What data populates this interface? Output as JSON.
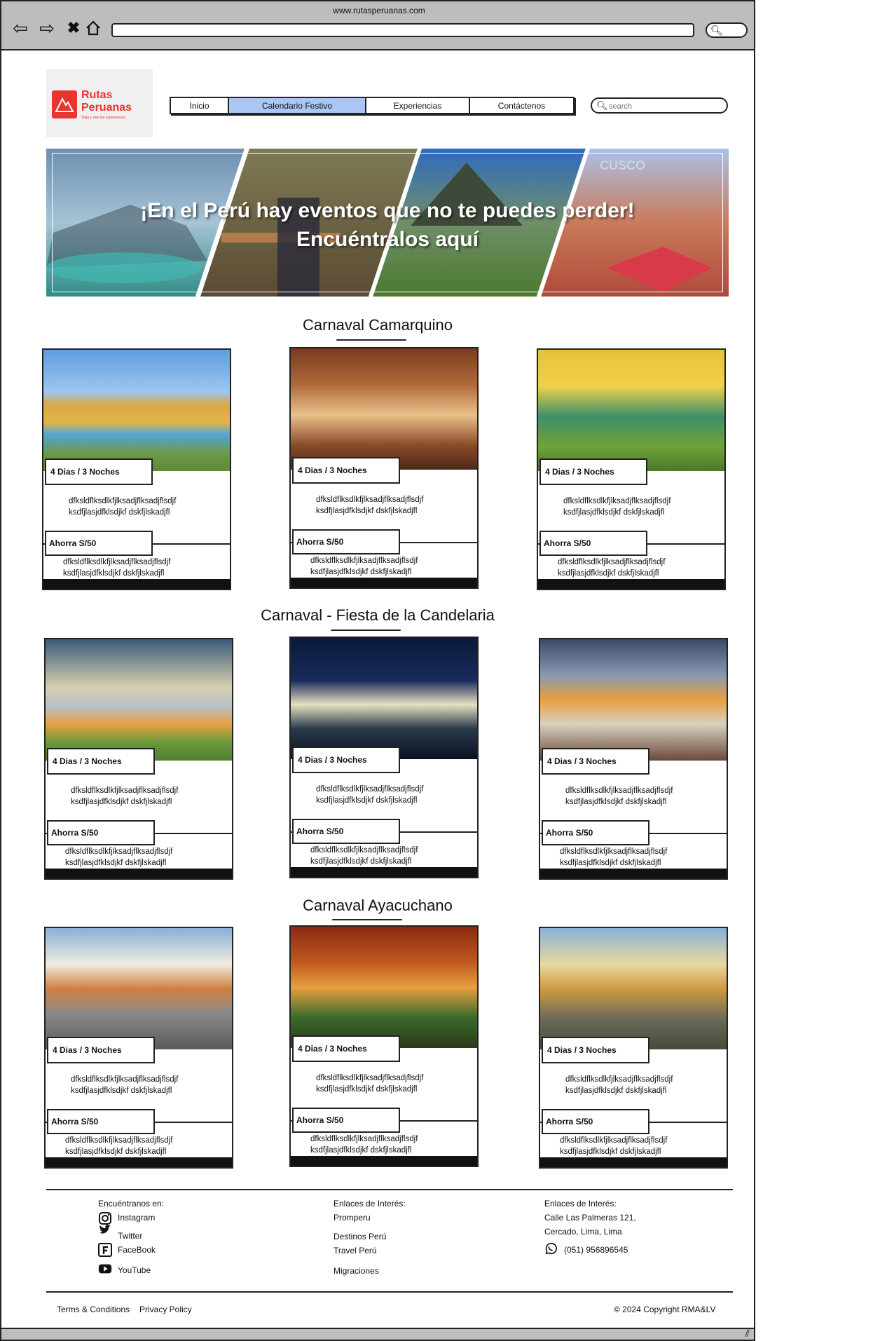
{
  "browser": {
    "url": "www.rutasperuanas.com"
  },
  "logo": {
    "name_line1": "Rutas",
    "name_line2": "Peruanas",
    "tagline": "Viaja y vive tus experiencias"
  },
  "menu": {
    "items": [
      {
        "label": "Inicio"
      },
      {
        "label": "Calendario Festivo"
      },
      {
        "label": "Experiencias"
      },
      {
        "label": "Contáctenos"
      }
    ],
    "active_index": 1,
    "active_color": "#a9c6f5"
  },
  "search": {
    "placeholder": "search"
  },
  "hero": {
    "title": "¡En el Perú hay eventos que no te puedes perder!",
    "subtitle": "Encuéntralos aquí",
    "watermark": "CUSCO"
  },
  "sections": [
    {
      "title": "Carnaval Camarquino",
      "cards": [
        {
          "duration": "4 Dias / 3 Noches",
          "desc_line1": "dfksldflksdlkfjlksadjflksadjflsdjf",
          "desc_line2": "ksdfjlasjdfklsdjkf dskfjlskadjfl",
          "price": "Ahorra S/50",
          "extra_line1": "dfksldflksdlkfjlksadjflksadjflsdjf",
          "extra_line2": "ksdfjlasjdfklsdjkf dskfjlskadjfl"
        },
        {
          "duration": "4 Dias / 3 Noches",
          "desc_line1": "dfksldflksdlkfjlksadjflksadjflsdjf",
          "desc_line2": "ksdfjlasjdfklsdjkf dskfjlskadjfl",
          "price": "Ahorra S/50",
          "extra_line1": "dfksldflksdlkfjlksadjflksadjflsdjf",
          "extra_line2": "ksdfjlasjdfklsdjkf dskfjlskadjfl"
        },
        {
          "duration": "4 Dias / 3 Noches",
          "desc_line1": "dfksldflksdlkfjlksadjflksadjflsdjf",
          "desc_line2": "ksdfjlasjdfklsdjkf dskfjlskadjfl",
          "price": "Ahorra S/50",
          "extra_line1": "dfksldflksdlkfjlksadjflksadjflsdjf",
          "extra_line2": "ksdfjlasjdfklsdjkf dskfjlskadjfl"
        }
      ]
    },
    {
      "title": "Carnaval - Fiesta de la Candelaria",
      "cards": [
        {
          "duration": "4 Dias / 3 Noches",
          "desc_line1": "dfksldflksdlkfjlksadjflksadjflsdjf",
          "desc_line2": "ksdfjlasjdfklsdjkf dskfjlskadjfl",
          "price": "Ahorra S/50",
          "extra_line1": "dfksldflksdlkfjlksadjflksadjflsdjf",
          "extra_line2": "ksdfjlasjdfklsdjkf dskfjlskadjfl"
        },
        {
          "duration": "4 Dias / 3 Noches",
          "desc_line1": "dfksldflksdlkfjlksadjflksadjflsdjf",
          "desc_line2": "ksdfjlasjdfklsdjkf dskfjlskadjfl",
          "price": "Ahorra S/50",
          "extra_line1": "dfksldflksdlkfjlksadjflksadjflsdjf",
          "extra_line2": "ksdfjlasjdfklsdjkf dskfjlskadjfl"
        },
        {
          "duration": "4 Dias / 3 Noches",
          "desc_line1": "dfksldflksdlkfjlksadjflksadjflsdjf",
          "desc_line2": "ksdfjlasjdfklsdjkf dskfjlskadjfl",
          "price": "Ahorra S/50",
          "extra_line1": "dfksldflksdlkfjlksadjflksadjflsdjf",
          "extra_line2": "ksdfjlasjdfklsdjkf dskfjlskadjfl"
        }
      ]
    },
    {
      "title": "Carnaval Ayacuchano",
      "cards": [
        {
          "duration": "4 Dias / 3 Noches",
          "desc_line1": "dfksldflksdlkfjlksadjflksadjflsdjf",
          "desc_line2": "ksdfjlasjdfklsdjkf dskfjlskadjfl",
          "price": "Ahorra S/50",
          "extra_line1": "dfksldflksdlkfjlksadjflksadjflsdjf",
          "extra_line2": "ksdfjlasjdfklsdjkf dskfjlskadjfl"
        },
        {
          "duration": "4 Dias / 3 Noches",
          "desc_line1": "dfksldflksdlkfjlksadjflksadjflsdjf",
          "desc_line2": "ksdfjlasjdfklsdjkf dskfjlskadjfl",
          "price": "Ahorra S/50",
          "extra_line1": "dfksldflksdlkfjlksadjflksadjflsdjf",
          "extra_line2": "ksdfjlasjdfklsdjkf dskfjlskadjfl"
        },
        {
          "duration": "4 Dias / 3 Noches",
          "desc_line1": "dfksldflksdlkfjlksadjflksadjflsdjf",
          "desc_line2": "ksdfjlasjdfklsdjkf dskfjlskadjfl",
          "price": "Ahorra S/50",
          "extra_line1": "dfksldflksdlkfjlksadjflksadjflsdjf",
          "extra_line2": "ksdfjlasjdfklsdjkf dskfjlskadjfl"
        }
      ]
    }
  ],
  "footer": {
    "social_title": "Encuéntranos en:",
    "social": [
      {
        "label": "Instagram",
        "icon": "instagram-icon"
      },
      {
        "label": "Twitter",
        "icon": "twitter-icon"
      },
      {
        "label": "FaceBook",
        "icon": "facebook-icon"
      },
      {
        "label": "YouTube",
        "icon": "youtube-icon"
      }
    ],
    "links_title": "Enlaces de Interés:",
    "links": [
      {
        "label": "Promperu"
      },
      {
        "label": "Destinos Perú"
      },
      {
        "label": "Travel Perú"
      },
      {
        "label": "Migraciones"
      }
    ],
    "contact_title": "Enlaces de Interés:",
    "address_line1": "Calle Las Palmeras 121,",
    "address_line2": "Cercado, Lima, Lima",
    "phone": "(051) 956896545",
    "terms": "Terms & Conditions",
    "privacy": "Privacy Policy",
    "copyright": "© 2024 Copyright RMA&LV"
  }
}
